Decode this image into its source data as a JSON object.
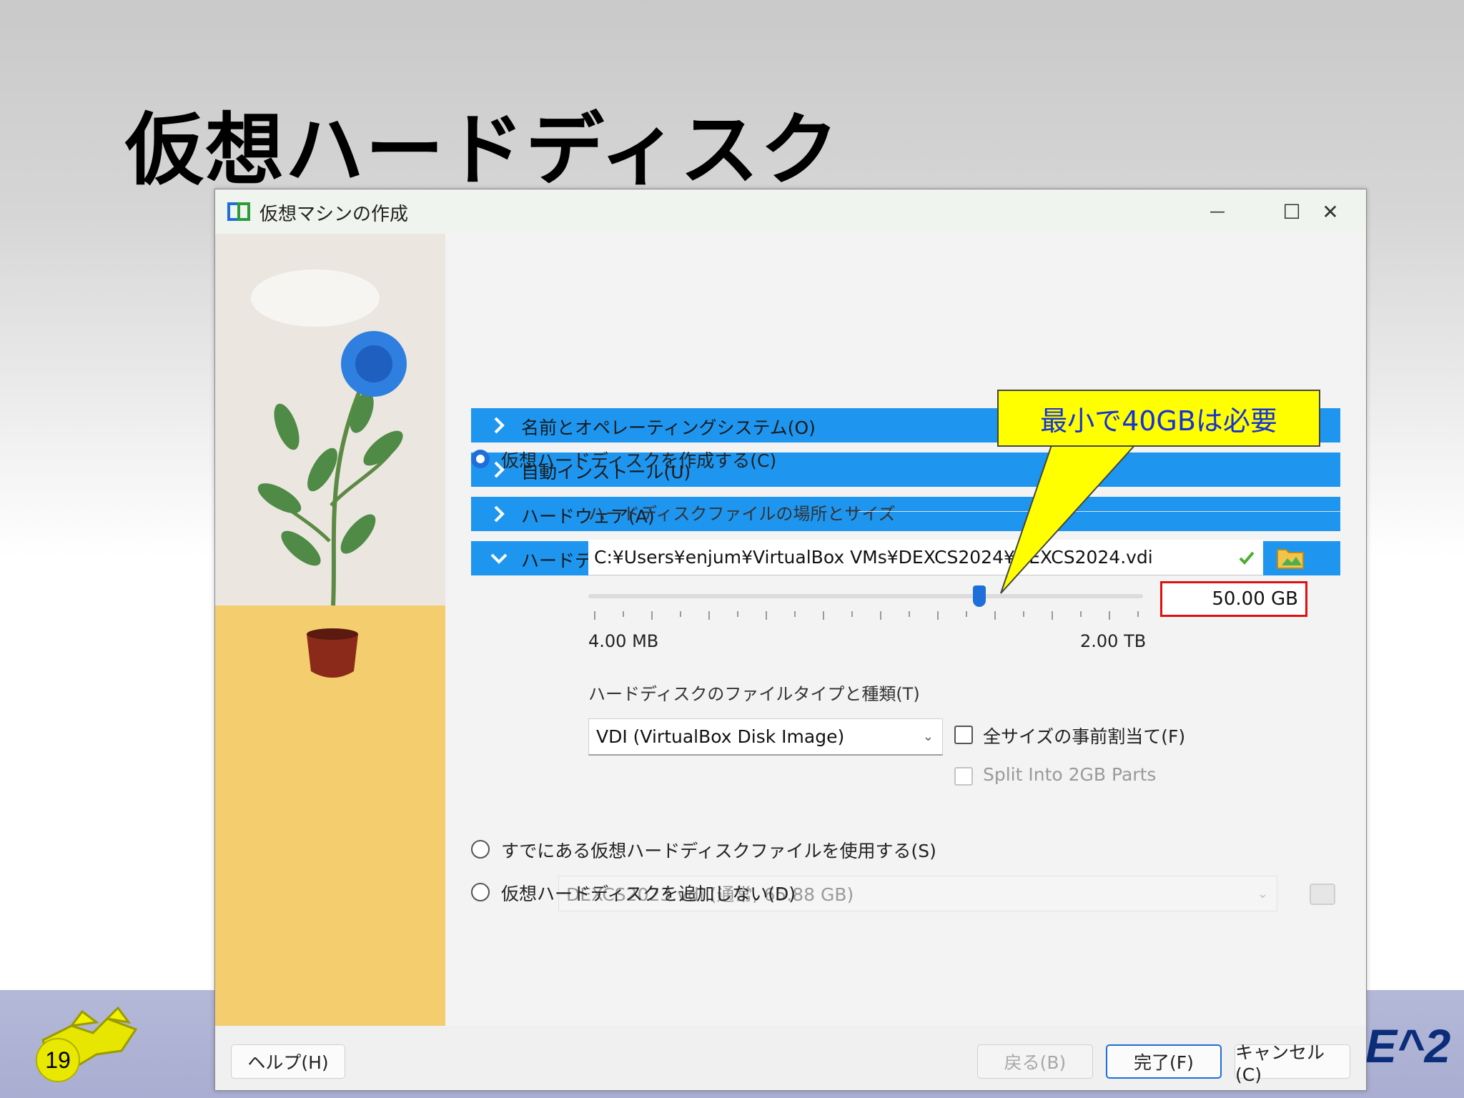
{
  "slide": {
    "title": "仮想ハードディスク",
    "page_number": "19",
    "right_logo_text": "E^2"
  },
  "window": {
    "title": "仮想マシンの作成",
    "controls": {
      "minimize": "—",
      "maximize": "☐",
      "close": "✕"
    }
  },
  "sections": [
    {
      "label": "名前とオペレーティングシステム(O)",
      "expanded": false
    },
    {
      "label": "自動インストール(U)",
      "expanded": false
    },
    {
      "label": "ハードウェア(A)",
      "expanded": false
    },
    {
      "label": "ハードディスク(K)",
      "expanded": true
    }
  ],
  "harddisk": {
    "create_option": {
      "label": "仮想ハードディスクを作成する(C)",
      "selected": true
    },
    "location_group_label": "ハードディスクファイルの場所とサイズ",
    "file_path": "C:¥Users¥enjum¥VirtualBox VMs¥DEXCS2024¥DEXCS2024.vdi",
    "slider": {
      "min_label": "4.00 MB",
      "max_label": "2.00 TB",
      "value_gb": 50
    },
    "size_value": "50.00 GB",
    "type_group_label": "ハードディスクのファイルタイプと種類(T)",
    "type_selected": "VDI (VirtualBox Disk Image)",
    "preallocate_label": "全サイズの事前割当て(F)",
    "preallocate_checked": false,
    "split_label": "Split Into 2GB Parts",
    "split_checked": false,
    "existing_option": {
      "label": "すでにある仮想ハードディスクファイルを使用する(S)",
      "selected": false
    },
    "existing_selected": "DEXCS2023.vdi (通常, 65.88 GB)",
    "none_option": {
      "label": "仮想ハードディスクを追加しない(D)",
      "selected": false
    }
  },
  "buttons": {
    "help": "ヘルプ(H)",
    "back": "戻る(B)",
    "finish": "完了(F)",
    "cancel": "キャンセル(C)"
  },
  "callout": {
    "text": "最小で40GBは必要"
  },
  "colors": {
    "accent": "#1e96f0",
    "callout_fill": "#ffff00",
    "callout_text": "#1533d6",
    "highlight_border": "#e01010"
  }
}
